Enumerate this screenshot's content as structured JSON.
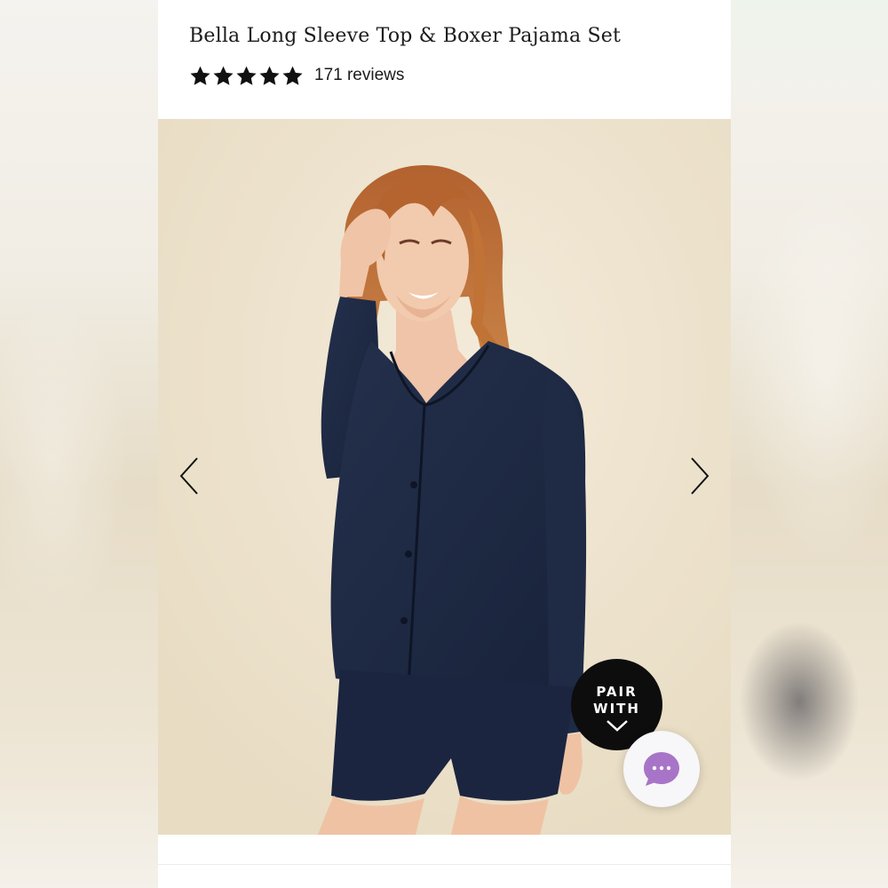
{
  "product": {
    "title": "Bella Long Sleeve Top & Boxer Pajama Set",
    "rating": 5,
    "rating_max": 5,
    "reviews_label": "171 reviews"
  },
  "gallery": {
    "image_icon": "product-photo",
    "prev_icon": "chevron-left-icon",
    "next_icon": "chevron-right-icon"
  },
  "pair_with": {
    "label": "PAIR WITH",
    "icon": "chevron-down-icon"
  },
  "chat": {
    "icon": "chat-bubble-icon",
    "accent": "#a874c8"
  },
  "colors": {
    "page_bg": "#ffffff",
    "text": "#1b1b1b",
    "image_bg": "#ece1cb",
    "garment": "#1e2a45",
    "pair_with_bg": "#0d0d0d"
  }
}
